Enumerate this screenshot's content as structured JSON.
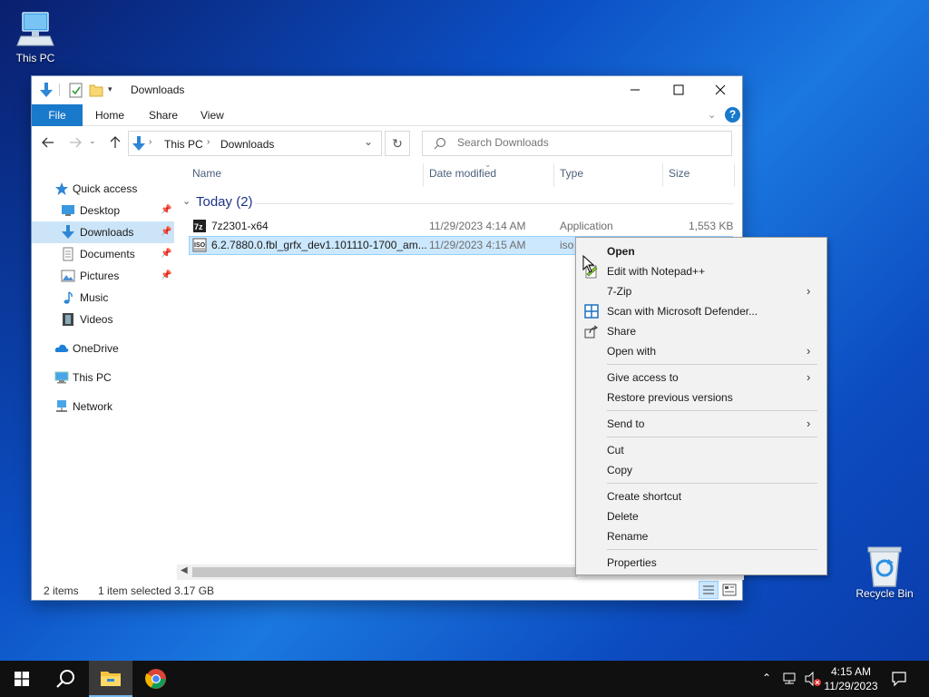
{
  "desktop": {
    "this_pc_label": "This PC",
    "recycle_bin_label": "Recycle Bin"
  },
  "window": {
    "title": "Downloads",
    "ribbon_tabs": [
      "File",
      "Home",
      "Share",
      "View"
    ],
    "breadcrumb": [
      "This PC",
      "Downloads"
    ],
    "search_placeholder": "Search Downloads"
  },
  "nav_pane": {
    "items": [
      {
        "label": "Quick access",
        "icon": "star-icon"
      },
      {
        "label": "Desktop",
        "icon": "desktop-folder-icon",
        "pinned": true
      },
      {
        "label": "Downloads",
        "icon": "downloads-folder-icon",
        "pinned": true,
        "selected": true
      },
      {
        "label": "Documents",
        "icon": "documents-folder-icon",
        "pinned": true
      },
      {
        "label": "Pictures",
        "icon": "pictures-folder-icon",
        "pinned": true
      },
      {
        "label": "Music",
        "icon": "music-folder-icon"
      },
      {
        "label": "Videos",
        "icon": "videos-folder-icon"
      },
      {
        "label": "OneDrive",
        "icon": "cloud-icon"
      },
      {
        "label": "This PC",
        "icon": "computer-icon"
      },
      {
        "label": "Network",
        "icon": "network-icon"
      }
    ]
  },
  "file_list": {
    "columns": [
      "Name",
      "Date modified",
      "Type",
      "Size"
    ],
    "group_label": "Today (2)",
    "rows": [
      {
        "name": "7z2301-x64",
        "date": "11/29/2023 4:14 AM",
        "type": "Application",
        "size": "1,553 KB",
        "icon": "7zip-installer-icon"
      },
      {
        "name": "6.2.7880.0.fbl_grfx_dev1.101110-1700_am...",
        "date": "11/29/2023 4:15 AM",
        "type": "iso",
        "size": "",
        "icon": "iso-file-icon",
        "selected": true
      }
    ]
  },
  "status_bar": {
    "item_count": "2 items",
    "selection": "1 item selected",
    "selection_size": "3.17 GB"
  },
  "context_menu": {
    "items": [
      {
        "label": "Open",
        "bold": true
      },
      {
        "label": "Edit with Notepad++",
        "icon": "notepadpp-icon"
      },
      {
        "label": "7-Zip",
        "submenu": true
      },
      {
        "label": "Scan with Microsoft Defender...",
        "icon": "defender-icon"
      },
      {
        "label": "Share",
        "icon": "share-icon"
      },
      {
        "label": "Open with",
        "submenu": true
      },
      {
        "label": "Give access to",
        "submenu": true
      },
      {
        "label": "Restore previous versions"
      },
      {
        "label": "Send to",
        "submenu": true
      },
      {
        "label": "Cut"
      },
      {
        "label": "Copy"
      },
      {
        "label": "Create shortcut"
      },
      {
        "label": "Delete"
      },
      {
        "label": "Rename"
      },
      {
        "label": "Properties"
      }
    ]
  },
  "taskbar": {
    "time": "4:15 AM",
    "date": "11/29/2023"
  },
  "colors": {
    "accent": "#1979ca",
    "selection": "#cce8ff",
    "taskbar": "#101010"
  }
}
